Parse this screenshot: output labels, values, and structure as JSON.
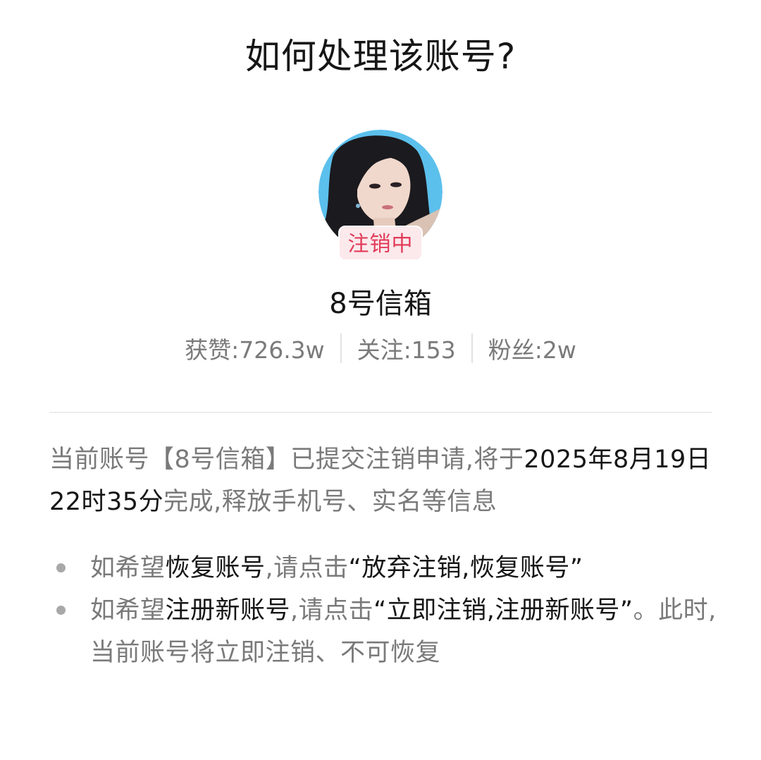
{
  "page_title": "如何处理该账号?",
  "profile": {
    "avatar_alt": "用户头像",
    "status_badge": "注销中",
    "nickname": "8号信箱"
  },
  "stats": [
    {
      "label": "获赞:",
      "value": "726.3w"
    },
    {
      "label": "关注:",
      "value": "153"
    },
    {
      "label": "粉丝:",
      "value": "2w"
    }
  ],
  "description": {
    "part1": "当前账号【8号信箱】已提交注销申请,将于",
    "deadline": "2025年8月19日22时35分",
    "part2": "完成,释放手机号、实名等信息"
  },
  "options": [
    {
      "prefix": "如希望",
      "action": "恢复账号",
      "mid": ",请点击",
      "button_quote": "“放弃注销,恢复账号”",
      "suffix": ""
    },
    {
      "prefix": "如希望",
      "action": "注册新账号",
      "mid": ",请点击",
      "button_quote": "“立即注销,注册新账号”",
      "suffix": "。此时,当前账号将立即注销、不可恢复"
    }
  ],
  "colors": {
    "badge_text": "#e23a58",
    "badge_bg": "#fbe9ec",
    "muted_text": "#7a7a7a",
    "strong_text": "#161616"
  }
}
